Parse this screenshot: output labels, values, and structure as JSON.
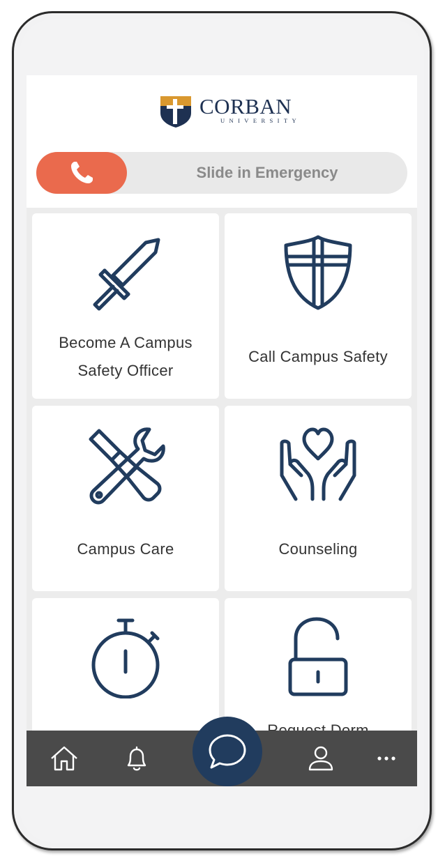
{
  "logo": {
    "name": "CORBAN",
    "sub": "UNIVERSITY"
  },
  "emergency": {
    "label": "Slide in Emergency"
  },
  "tiles": [
    {
      "label": "Become A Campus Safety Officer",
      "icon": "sword-icon"
    },
    {
      "label": "Call Campus Safety",
      "icon": "cross-shield-icon"
    },
    {
      "label": "Campus Care",
      "icon": "tools-icon"
    },
    {
      "label": "Counseling",
      "icon": "heart-hands-icon"
    },
    {
      "label": "",
      "icon": "stopwatch-icon"
    },
    {
      "label": "Request Dorm",
      "icon": "unlock-icon"
    }
  ],
  "nav": {
    "items": [
      "home-icon",
      "bell-icon",
      "chat-icon",
      "user-icon",
      "more-icon"
    ]
  },
  "colors": {
    "navy": "#213c5e",
    "emergency": "#ea6a4d",
    "navbar": "#4a4a4a",
    "logo_gold": "#d9982f"
  }
}
